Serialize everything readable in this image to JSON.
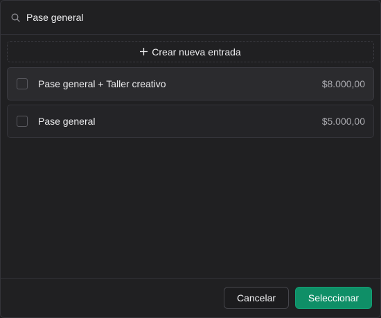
{
  "search": {
    "value": "Pase general",
    "icon": "search-icon"
  },
  "create": {
    "label": "Crear nueva entrada",
    "icon": "plus-icon"
  },
  "tickets": [
    {
      "name": "Pase general + Taller creativo",
      "price": "$8.000,00",
      "checked": false
    },
    {
      "name": "Pase general",
      "price": "$5.000,00",
      "checked": false
    }
  ],
  "footer": {
    "cancel_label": "Cancelar",
    "select_label": "Seleccionar"
  },
  "colors": {
    "background": "#202022",
    "accent": "#0f8f67",
    "border": "#34343a"
  }
}
